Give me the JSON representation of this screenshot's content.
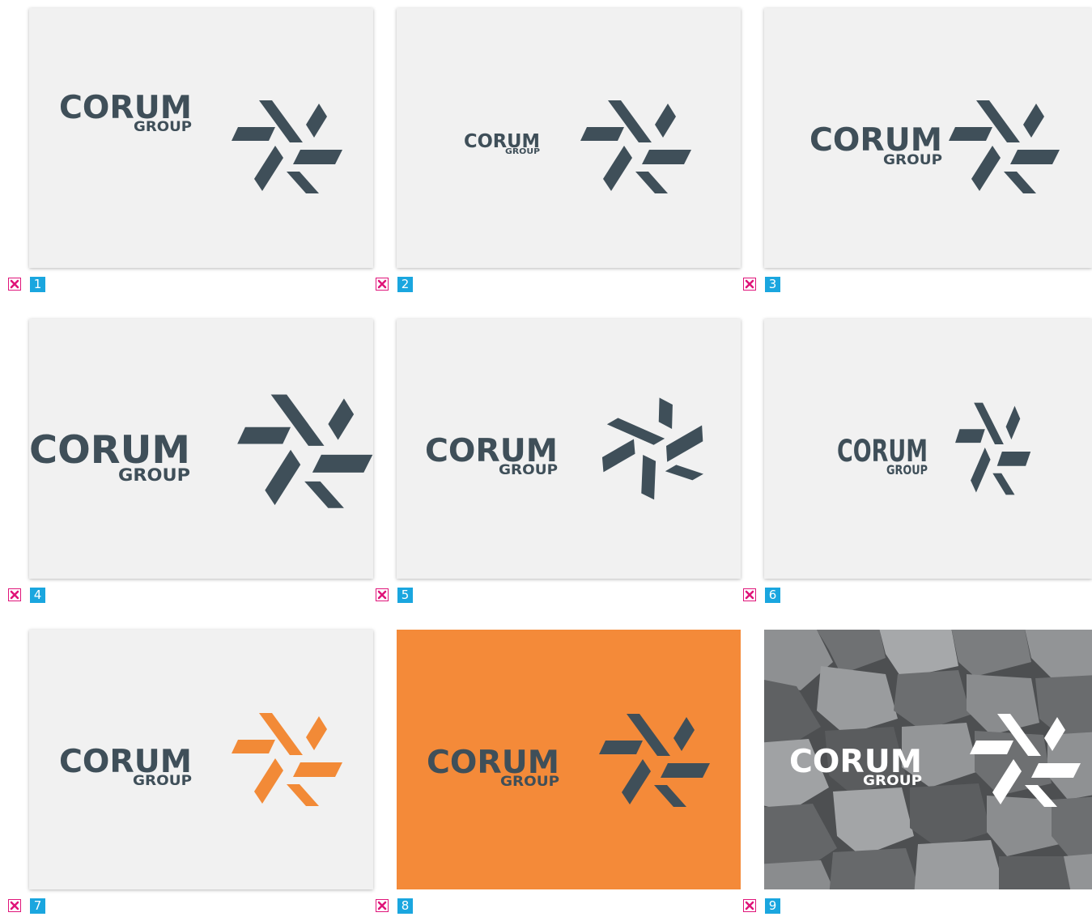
{
  "gallery": {
    "brand_name": "CORUM",
    "brand_sub": "GROUP",
    "items": [
      {
        "number": "1",
        "background": "#f1f1f1",
        "text_color": "#3f4f59",
        "mark_color": "#3f4f59",
        "variant": "default"
      },
      {
        "number": "2",
        "background": "#f1f1f1",
        "text_color": "#3f4f59",
        "mark_color": "#3f4f59",
        "variant": "small-text"
      },
      {
        "number": "3",
        "background": "#f1f1f1",
        "text_color": "#3f4f59",
        "mark_color": "#3f4f59",
        "variant": "tight"
      },
      {
        "number": "4",
        "background": "#f1f1f1",
        "text_color": "#3f4f59",
        "mark_color": "#3f4f59",
        "variant": "large"
      },
      {
        "number": "5",
        "background": "#f1f1f1",
        "text_color": "#3f4f59",
        "mark_color": "#3f4f59",
        "variant": "rotated"
      },
      {
        "number": "6",
        "background": "#f1f1f1",
        "text_color": "#3f4f59",
        "mark_color": "#3f4f59",
        "variant": "condensed"
      },
      {
        "number": "7",
        "background": "#f1f1f1",
        "text_color": "#3f4f59",
        "mark_color": "#f28a37",
        "variant": "orange-mark"
      },
      {
        "number": "8",
        "background": "#f48a39",
        "text_color": "#3f4f59",
        "mark_color": "#3f4f59",
        "variant": "orange-bg"
      },
      {
        "number": "9",
        "background": "#5a5c5e",
        "text_color": "#ffffff",
        "mark_color": "#ffffff",
        "variant": "rocks"
      }
    ]
  },
  "colors": {
    "accent_blue": "#1aa6df",
    "delete_pink": "#e0157a"
  },
  "icons": {
    "delete": "close-x-icon"
  }
}
